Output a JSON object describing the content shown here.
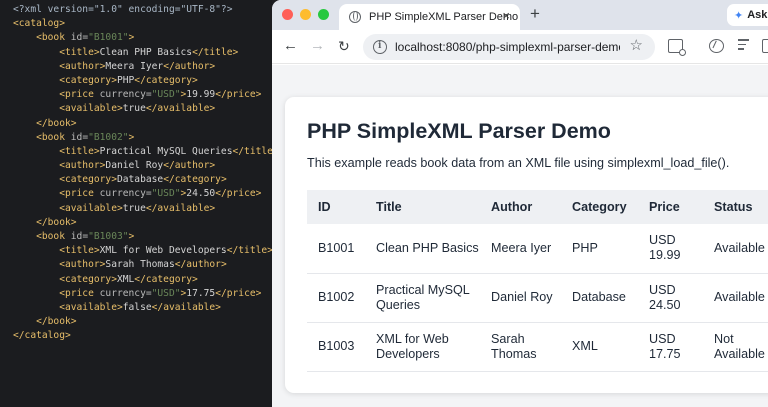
{
  "editor": {
    "lines": [
      {
        "segments": [
          {
            "t": "<?xml version=\"1.0\" encoding=\"UTF-8\"?>",
            "c": "c-decl"
          }
        ]
      },
      {
        "segments": [
          {
            "t": "<catalog>",
            "c": "c-tag"
          }
        ]
      },
      {
        "segments": [
          {
            "t": "    <book ",
            "c": "c-tag"
          },
          {
            "t": "id=",
            "c": "c-attr"
          },
          {
            "t": "\"B1001\"",
            "c": "c-val"
          },
          {
            "t": ">",
            "c": "c-tag"
          }
        ]
      },
      {
        "segments": [
          {
            "t": "        <title>",
            "c": "c-tag"
          },
          {
            "t": "Clean PHP Basics",
            "c": "c-text"
          },
          {
            "t": "</title>",
            "c": "c-tag"
          }
        ]
      },
      {
        "segments": [
          {
            "t": "        <author>",
            "c": "c-tag"
          },
          {
            "t": "Meera Iyer",
            "c": "c-text"
          },
          {
            "t": "</author>",
            "c": "c-tag"
          }
        ]
      },
      {
        "segments": [
          {
            "t": "        <category>",
            "c": "c-tag"
          },
          {
            "t": "PHP",
            "c": "c-text"
          },
          {
            "t": "</category>",
            "c": "c-tag"
          }
        ]
      },
      {
        "segments": [
          {
            "t": "        <price ",
            "c": "c-tag"
          },
          {
            "t": "currency=",
            "c": "c-attr"
          },
          {
            "t": "\"USD\"",
            "c": "c-val"
          },
          {
            "t": ">",
            "c": "c-tag"
          },
          {
            "t": "19.99",
            "c": "c-text"
          },
          {
            "t": "</price>",
            "c": "c-tag"
          }
        ]
      },
      {
        "segments": [
          {
            "t": "        <available>",
            "c": "c-tag"
          },
          {
            "t": "true",
            "c": "c-text"
          },
          {
            "t": "</available>",
            "c": "c-tag"
          }
        ]
      },
      {
        "segments": [
          {
            "t": "    </book>",
            "c": "c-tag"
          }
        ]
      },
      {
        "segments": [
          {
            "t": "    <book ",
            "c": "c-tag"
          },
          {
            "t": "id=",
            "c": "c-attr"
          },
          {
            "t": "\"B1002\"",
            "c": "c-val"
          },
          {
            "t": ">",
            "c": "c-tag"
          }
        ]
      },
      {
        "segments": [
          {
            "t": "        <title>",
            "c": "c-tag"
          },
          {
            "t": "Practical MySQL Queries",
            "c": "c-text"
          },
          {
            "t": "</title>",
            "c": "c-tag"
          }
        ]
      },
      {
        "segments": [
          {
            "t": "        <author>",
            "c": "c-tag"
          },
          {
            "t": "Daniel Roy",
            "c": "c-text"
          },
          {
            "t": "</author>",
            "c": "c-tag"
          }
        ]
      },
      {
        "segments": [
          {
            "t": "        <category>",
            "c": "c-tag"
          },
          {
            "t": "Database",
            "c": "c-text"
          },
          {
            "t": "</category>",
            "c": "c-tag"
          }
        ]
      },
      {
        "segments": [
          {
            "t": "        <price ",
            "c": "c-tag"
          },
          {
            "t": "currency=",
            "c": "c-attr"
          },
          {
            "t": "\"USD\"",
            "c": "c-val"
          },
          {
            "t": ">",
            "c": "c-tag"
          },
          {
            "t": "24.50",
            "c": "c-text"
          },
          {
            "t": "</price>",
            "c": "c-tag"
          }
        ]
      },
      {
        "segments": [
          {
            "t": "        <available>",
            "c": "c-tag"
          },
          {
            "t": "true",
            "c": "c-text"
          },
          {
            "t": "</available>",
            "c": "c-tag"
          }
        ]
      },
      {
        "segments": [
          {
            "t": "    </book>",
            "c": "c-tag"
          }
        ]
      },
      {
        "segments": [
          {
            "t": "    <book ",
            "c": "c-tag"
          },
          {
            "t": "id=",
            "c": "c-attr"
          },
          {
            "t": "\"B1003\"",
            "c": "c-val"
          },
          {
            "t": ">",
            "c": "c-tag"
          }
        ]
      },
      {
        "segments": [
          {
            "t": "        <title>",
            "c": "c-tag"
          },
          {
            "t": "XML for Web Developers",
            "c": "c-text"
          },
          {
            "t": "</title>",
            "c": "c-tag"
          }
        ]
      },
      {
        "segments": [
          {
            "t": "        <author>",
            "c": "c-tag"
          },
          {
            "t": "Sarah Thomas",
            "c": "c-text"
          },
          {
            "t": "</author>",
            "c": "c-tag"
          }
        ]
      },
      {
        "segments": [
          {
            "t": "        <category>",
            "c": "c-tag"
          },
          {
            "t": "XML",
            "c": "c-text"
          },
          {
            "t": "</category>",
            "c": "c-tag"
          }
        ]
      },
      {
        "segments": [
          {
            "t": "        <price ",
            "c": "c-tag"
          },
          {
            "t": "currency=",
            "c": "c-attr"
          },
          {
            "t": "\"USD\"",
            "c": "c-val"
          },
          {
            "t": ">",
            "c": "c-tag"
          },
          {
            "t": "17.75",
            "c": "c-text"
          },
          {
            "t": "</price>",
            "c": "c-tag"
          }
        ]
      },
      {
        "segments": [
          {
            "t": "        <available>",
            "c": "c-tag"
          },
          {
            "t": "false",
            "c": "c-text"
          },
          {
            "t": "</available>",
            "c": "c-tag"
          }
        ]
      },
      {
        "segments": [
          {
            "t": "    </book>",
            "c": "c-tag"
          }
        ]
      },
      {
        "segments": [
          {
            "t": "</catalog>",
            "c": "c-tag"
          }
        ]
      }
    ]
  },
  "browser": {
    "tab_title": "PHP SimpleXML Parser Demo",
    "tab_close": "×",
    "new_tab": "+",
    "ask_label": "Ask",
    "ask_icon": "sparkle-icon",
    "url": "localhost:8080/php-simplexml-parser-demo",
    "nav_back": "←",
    "nav_forward": "→",
    "nav_reload": "↻",
    "bookmark": "☆"
  },
  "page": {
    "title": "PHP SimpleXML Parser Demo",
    "description": "This example reads book data from an XML file using simplexml_load_file().",
    "table": {
      "headers": [
        "ID",
        "Title",
        "Author",
        "Category",
        "Price",
        "Status"
      ],
      "rows": [
        {
          "id": "B1001",
          "title": "Clean PHP Basics",
          "author": "Meera Iyer",
          "category": "PHP",
          "price": "USD 19.99",
          "status": "Available"
        },
        {
          "id": "B1002",
          "title": "Practical MySQL Queries",
          "author": "Daniel Roy",
          "category": "Database",
          "price": "USD 24.50",
          "status": "Available"
        },
        {
          "id": "B1003",
          "title": "XML for Web Developers",
          "author": "Sarah Thomas",
          "category": "XML",
          "price": "USD 17.75",
          "status": "Not Available"
        }
      ]
    }
  },
  "colors": {
    "editor_bg": "#1b1c1f",
    "xml_tag": "#e8bf6a",
    "xml_value": "#6a8759",
    "table_header_bg": "#eef0f3",
    "traffic_red": "#ff5f57",
    "traffic_yellow": "#febc2e",
    "traffic_green": "#28c840"
  }
}
